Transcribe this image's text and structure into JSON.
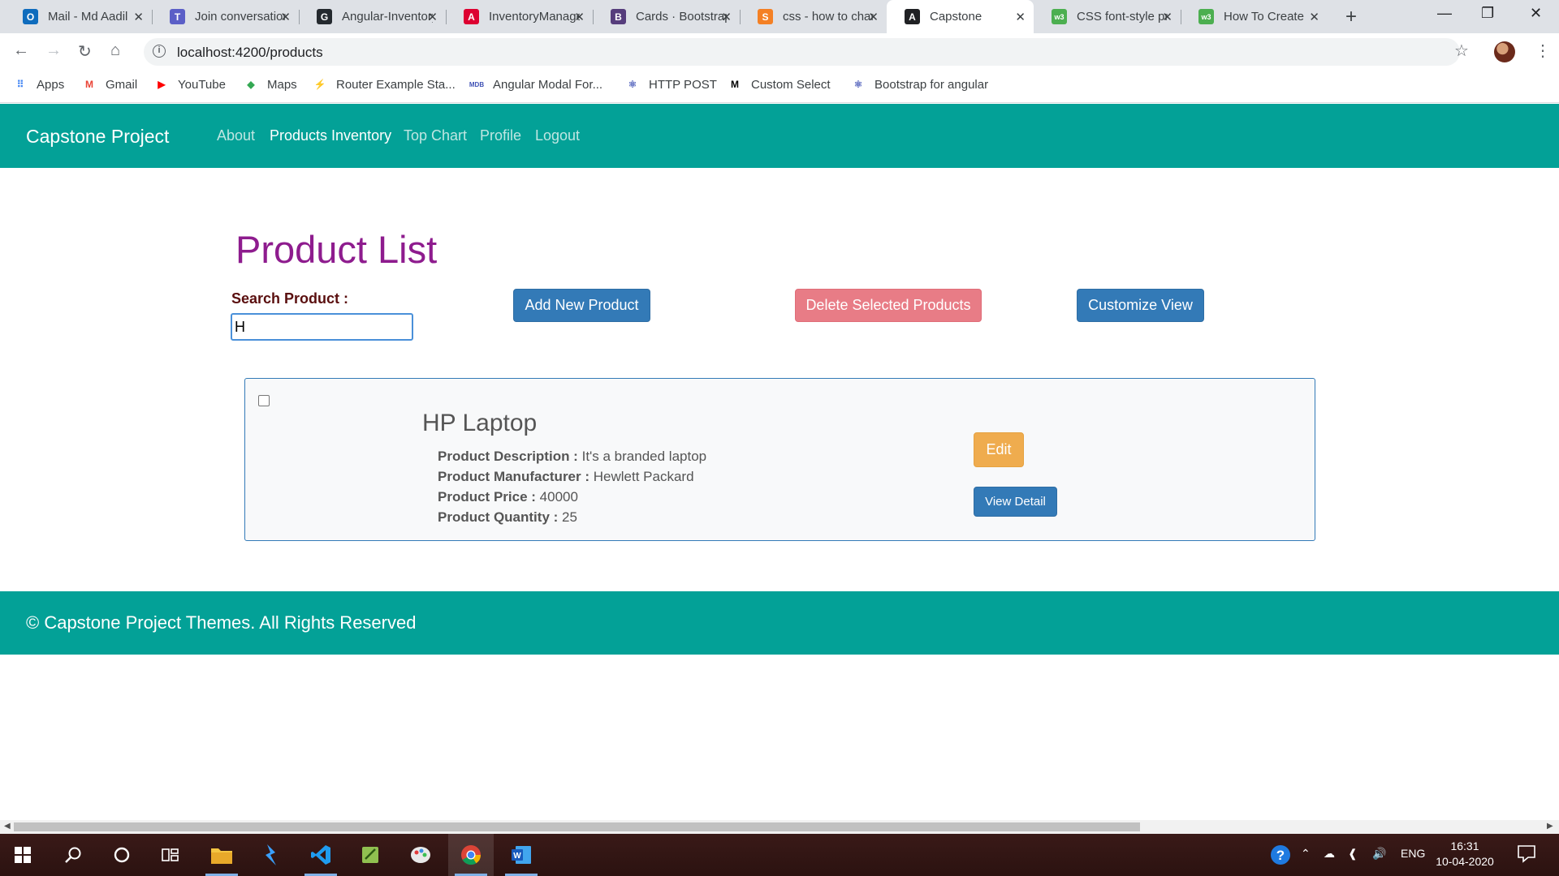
{
  "browser": {
    "tabs": [
      {
        "title": "Mail - Md Aadil",
        "icon": "outlook-icon",
        "color": "#0f6cbd",
        "glyph": "O"
      },
      {
        "title": "Join conversation",
        "icon": "teams-icon",
        "color": "#5b5fc7",
        "glyph": "T"
      },
      {
        "title": "Angular-Inventory",
        "icon": "github-icon",
        "color": "#24292e",
        "glyph": "G"
      },
      {
        "title": "InventoryManagement",
        "icon": "angular-icon",
        "color": "#dd0031",
        "glyph": "A"
      },
      {
        "title": "Cards · Bootstrap",
        "icon": "bootstrap-icon",
        "color": "#563d7c",
        "glyph": "B"
      },
      {
        "title": "css - how to change",
        "icon": "stackoverflow-icon",
        "color": "#f48024",
        "glyph": "S"
      },
      {
        "title": "Capstone",
        "icon": "angular-icon",
        "color": "#202124",
        "glyph": "A"
      },
      {
        "title": "CSS font-style property",
        "icon": "w3schools-icon",
        "color": "#4caf50",
        "glyph": "w3"
      },
      {
        "title": "How To Create",
        "icon": "w3schools-icon",
        "color": "#4caf50",
        "glyph": "w3"
      }
    ],
    "new_tab": "+",
    "window_controls": {
      "minimize": "—",
      "maximize": "❐",
      "close": "✕"
    },
    "url": "localhost:4200/products",
    "bookmarks": [
      {
        "label": "Apps",
        "icon": "apps-grid-icon",
        "glyph": "⠿",
        "color": "#4285f4"
      },
      {
        "label": "Gmail",
        "icon": "gmail-icon",
        "glyph": "M",
        "color": "#ea4335"
      },
      {
        "label": "YouTube",
        "icon": "youtube-icon",
        "glyph": "▶",
        "color": "#ff0000"
      },
      {
        "label": "Maps",
        "icon": "maps-icon",
        "glyph": "◆",
        "color": "#34a853"
      },
      {
        "label": "Router Example Sta...",
        "icon": "stackblitz-icon",
        "glyph": "⚡",
        "color": "#1389fd"
      },
      {
        "label": "Angular Modal For...",
        "icon": "mdb-icon",
        "glyph": "MDB",
        "color": "#3f51b5"
      },
      {
        "label": "HTTP POST",
        "icon": "react-icon",
        "glyph": "⚛",
        "color": "#5c6bc0"
      },
      {
        "label": "Custom Select",
        "icon": "medium-icon",
        "glyph": "M",
        "color": "#000000"
      },
      {
        "label": "Bootstrap for angular",
        "icon": "react-icon",
        "glyph": "⚛",
        "color": "#5c6bc0"
      }
    ]
  },
  "app": {
    "brand": "Capstone Project",
    "nav": [
      {
        "label": "About",
        "active": false
      },
      {
        "label": "Products Inventory",
        "active": true
      },
      {
        "label": "Top Chart",
        "active": false
      },
      {
        "label": "Profile",
        "active": false
      },
      {
        "label": "Logout",
        "active": false
      }
    ],
    "title": "Product List",
    "search": {
      "label": "Search Product :",
      "value": "H"
    },
    "buttons": {
      "add": "Add New Product",
      "delete": "Delete Selected Products",
      "customize": "Customize View"
    },
    "product": {
      "name": "HP Laptop",
      "checked": false,
      "description_label": "Product Description :",
      "description": "It's a branded laptop",
      "manufacturer_label": "Product Manufacturer :",
      "manufacturer": "Hewlett Packard",
      "price_label": "Product Price :",
      "price": "40000",
      "quantity_label": "Product Quantity :",
      "quantity": "25",
      "edit": "Edit",
      "view": "View Detail"
    },
    "footer": "© Capstone Project Themes. All Rights Reserved"
  },
  "colors": {
    "navbar": "#03a197",
    "title": "#8e1c8e",
    "primary": "#337ab7",
    "danger_disabled": "#e87c86",
    "warning": "#efac4e"
  },
  "taskbar": {
    "language": "ENG",
    "time": "16:31",
    "date": "10-04-2020"
  }
}
